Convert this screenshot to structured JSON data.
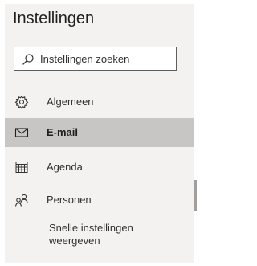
{
  "settings": {
    "title": "Instellingen",
    "search": {
      "placeholder": "Instellingen zoeken",
      "icon": "search-icon"
    },
    "nav": [
      {
        "label": "Algemeen",
        "icon": "gear-icon",
        "selected": false
      },
      {
        "label": "E-mail",
        "icon": "mail-icon",
        "selected": true
      },
      {
        "label": "Agenda",
        "icon": "calendar-icon",
        "selected": false
      },
      {
        "label": "Personen",
        "icon": "people-icon",
        "selected": false
      }
    ],
    "quick_settings": {
      "line1": "Snelle instellingen",
      "line2": "weergeven"
    }
  },
  "colors": {
    "panel_bg": "#f3f2f1",
    "selected_bg": "#c8c6c4",
    "text": "#323130"
  }
}
